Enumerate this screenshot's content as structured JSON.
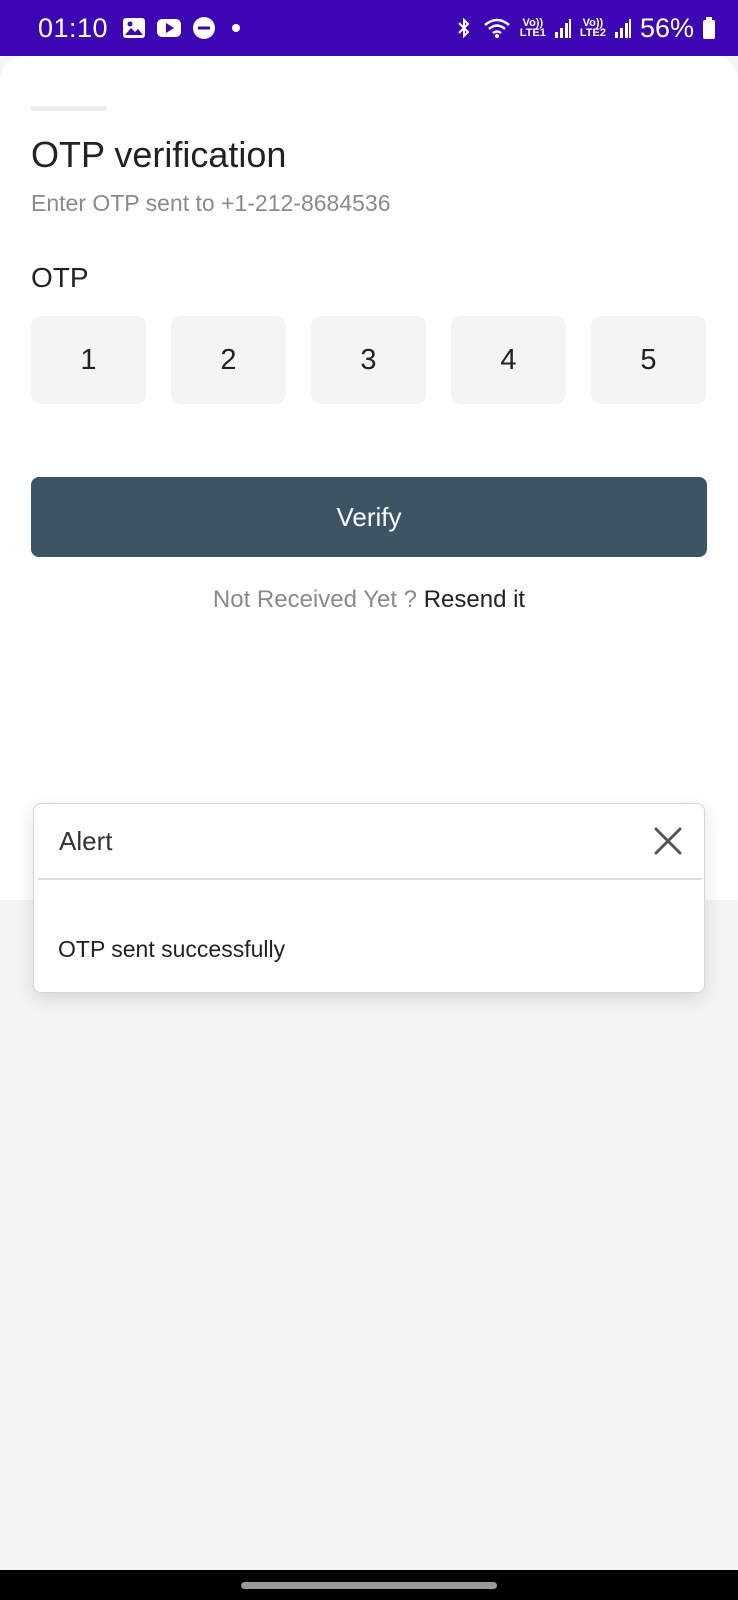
{
  "status_bar": {
    "time": "01:10",
    "battery": "56%",
    "sim1_top": "Vo))",
    "sim1_bottom": "LTE1",
    "sim2_top": "Vo))",
    "sim2_bottom": "LTE2",
    "icons": [
      "gallery-icon",
      "youtube-icon",
      "dnd-icon",
      "dot-icon",
      "bluetooth-icon",
      "wifi-icon",
      "signal-icon",
      "signal-icon",
      "battery-icon"
    ]
  },
  "screen": {
    "title": "OTP verification",
    "subtitle": "Enter OTP sent to +1-212-8684536",
    "otp_label": "OTP",
    "otp_digits": [
      "1",
      "2",
      "3",
      "4",
      "5"
    ],
    "verify_label": "Verify",
    "resend_prefix": "Not Received Yet ?",
    "resend_link": "Resend it"
  },
  "alert": {
    "title": "Alert",
    "message": "OTP sent successfully"
  },
  "colors": {
    "status_bar": "#3c06b5",
    "primary_button": "#3c5463",
    "otp_box_bg": "#f4f4f4"
  }
}
